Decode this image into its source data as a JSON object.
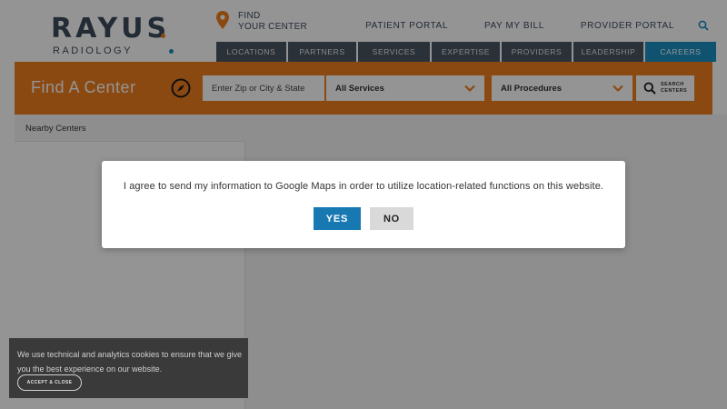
{
  "header": {
    "logo_main": "RAYUS",
    "logo_sub": "RADIOLOGY",
    "find_line1": "FIND",
    "find_line2": "YOUR CENTER",
    "top_links": [
      "PATIENT PORTAL",
      "PAY MY BILL",
      "PROVIDER PORTAL"
    ],
    "nav": [
      "LOCATIONS",
      "PARTNERS",
      "SERVICES",
      "EXPERTISE",
      "PROVIDERS",
      "LEADERSHIP",
      "CAREERS"
    ],
    "icons": {
      "pin": "map-pin-icon",
      "search": "search-icon"
    }
  },
  "search_bar": {
    "title": "Find A Center",
    "zip_placeholder": "Enter Zip or City & State",
    "services_selected": "All Services",
    "procedures_selected": "All Procedures",
    "search_line1": "SEARCH",
    "search_line2": "CENTERS"
  },
  "sidebar": {
    "title": "Nearby Centers"
  },
  "modal": {
    "message": "I agree to send my information to Google Maps in order to utilize location-related functions on this website.",
    "yes_label": "YES",
    "no_label": "NO"
  },
  "cookie": {
    "message": "We use technical and analytics cookies to ensure that we give you the best experience on our website.",
    "accept_label": "ACCEPT & CLOSE"
  },
  "colors": {
    "brand_orange": "#f07f1f",
    "nav_gray": "#4a5563",
    "nav_active": "#1b8fc2",
    "yes_blue": "#1879b2"
  }
}
